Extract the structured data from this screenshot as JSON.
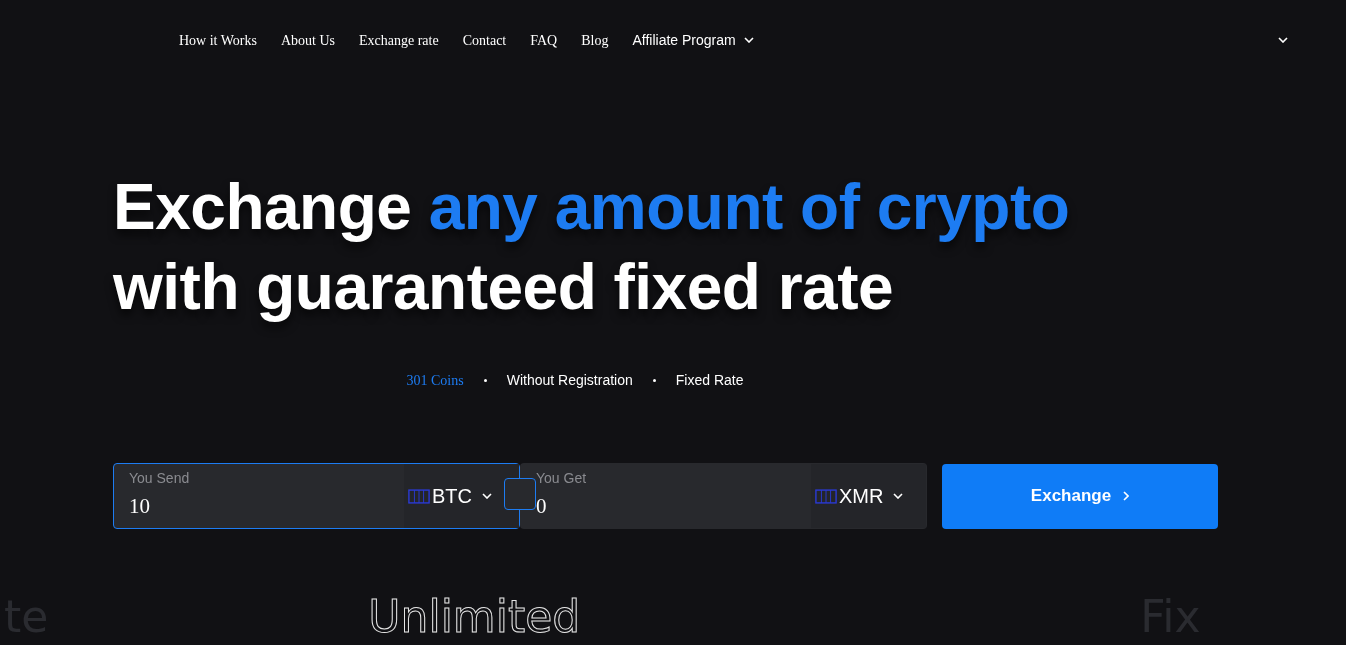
{
  "nav": {
    "links": [
      {
        "label": "How it Works",
        "kind": "link"
      },
      {
        "label": "About Us",
        "kind": "link"
      },
      {
        "label": "Exchange rate",
        "kind": "link"
      },
      {
        "label": "Contact",
        "kind": "link"
      },
      {
        "label": "FAQ",
        "kind": "link"
      },
      {
        "label": "Blog",
        "kind": "link"
      },
      {
        "label": "Affiliate Program",
        "kind": "dropdown"
      }
    ]
  },
  "menu_toggle": {
    "expanded": false
  },
  "hero": {
    "title_start": "Exchange ",
    "title_highlight": "any amount of crypto",
    "title_end": "with guaranteed fixed rate"
  },
  "features": [
    {
      "label": "301 Coins",
      "highlight": true
    },
    {
      "label": "Without Registration",
      "highlight": false
    },
    {
      "label": "Fixed Rate",
      "highlight": false
    }
  ],
  "exchange_form": {
    "send": {
      "label": "You Send",
      "value": "10",
      "currency": "BTC",
      "focused": true
    },
    "get": {
      "label": "You Get",
      "value": "0",
      "currency": "XMR",
      "focused": false
    },
    "button": "Exchange"
  },
  "marquee": [
    {
      "text": "te",
      "outlined": false
    },
    {
      "text": "Unlimited",
      "outlined": true
    },
    {
      "text": "Fix",
      "outlined": false
    }
  ]
}
